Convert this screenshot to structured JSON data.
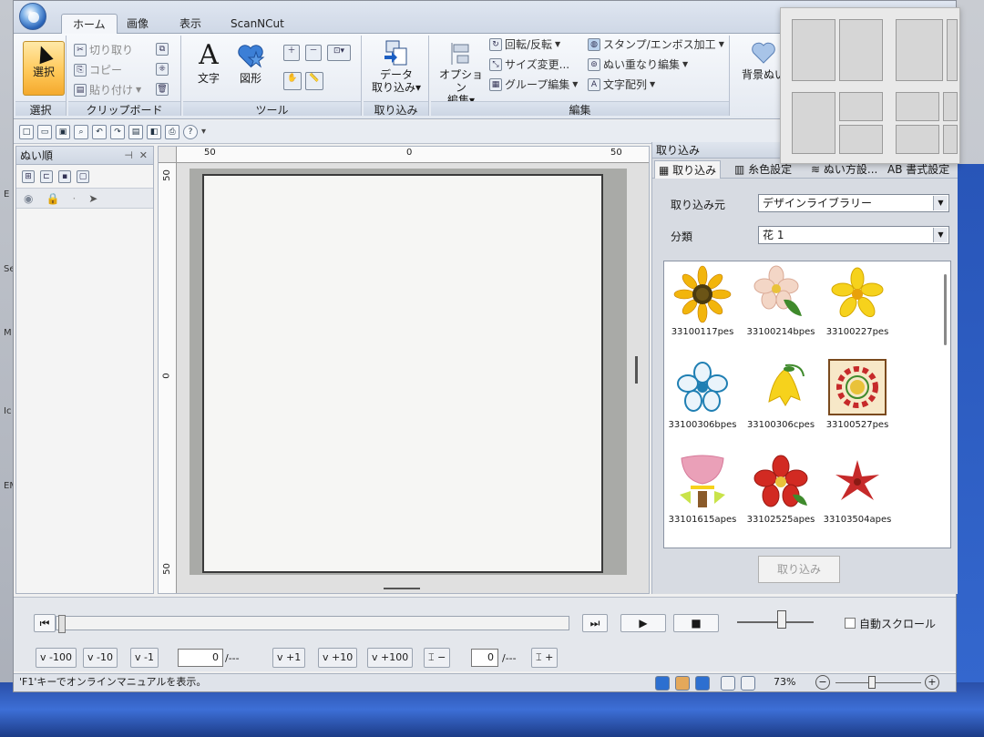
{
  "desktop": {
    "left_labels": [
      "E",
      "Se",
      "M",
      "Ic",
      "EM"
    ]
  },
  "tabs": [
    {
      "label": "ホーム",
      "active": true
    },
    {
      "label": "画像",
      "active": false
    },
    {
      "label": "表示",
      "active": false
    },
    {
      "label": "ScanNCut",
      "active": false
    }
  ],
  "ribbon": {
    "select_group": {
      "button": "選択",
      "label": "選択"
    },
    "clipboard": {
      "label": "クリップボード",
      "cut": "切り取り",
      "copy": "コピー",
      "paste": "貼り付け"
    },
    "tools": {
      "label": "ツール",
      "text": "文字",
      "shape": "図形"
    },
    "import": {
      "label": "取り込み",
      "data_import": "データ",
      "data_import2": "取り込み"
    },
    "edit": {
      "label": "編集",
      "option": "オプション",
      "option2": "編集",
      "rotate": "回転/反転",
      "resize": "サイズ変更...",
      "group": "グループ編集",
      "stamp": "スタンプ/エンボス加工",
      "overlap": "ぬい重なり編集",
      "text_arrange": "文字配列"
    },
    "background": {
      "label": "背景ぬい"
    }
  },
  "left_panel": {
    "title": "ぬい順"
  },
  "canvas": {
    "ruler_top": [
      "50",
      "0",
      "50"
    ],
    "ruler_left": [
      "50",
      "0",
      "50"
    ]
  },
  "right_panel": {
    "title": "取り込み",
    "tabs": [
      "取り込み",
      "糸色設定",
      "ぬい方設...",
      "書式設定"
    ],
    "source_label": "取り込み元",
    "source_value": "デザインライブラリー",
    "category_label": "分類",
    "category_value": "花 1",
    "import_button": "取り込み",
    "thumbnails": [
      {
        "file": "33100117pes",
        "icon": "sunflower-icon"
      },
      {
        "file": "33100214bpes",
        "icon": "pink-blossom-icon"
      },
      {
        "file": "33100227pes",
        "icon": "yellow-flower-icon"
      },
      {
        "file": "33100306bpes",
        "icon": "blue-flower-icon"
      },
      {
        "file": "33100306cpes",
        "icon": "bellflower-icon"
      },
      {
        "file": "33100527pes",
        "icon": "red-floral-frame-icon"
      },
      {
        "file": "33101615apes",
        "icon": "pink-lotus-icon"
      },
      {
        "file": "33102525apes",
        "icon": "red-flower-icon"
      },
      {
        "file": "33103504apes",
        "icon": "red-star-flower-icon"
      }
    ]
  },
  "playback": {
    "auto_scroll_label": "自動スクロール"
  },
  "stepbar": {
    "minus100": "-100",
    "minus10": "-10",
    "minus1": "-1",
    "count_value": "0",
    "count_total": "/---",
    "plus1": "+1",
    "plus10": "+10",
    "plus100": "+100",
    "color_minus": "−",
    "color_value": "0",
    "color_total": "/---",
    "color_plus": "+"
  },
  "statusbar": {
    "message": "'F1'キーでオンラインマニュアルを表示。",
    "zoom": "73%"
  },
  "colors": {
    "accent": "#ffc95a",
    "ribbon_bg": "#e4e9f1",
    "hoop": "#a9aaa7"
  }
}
